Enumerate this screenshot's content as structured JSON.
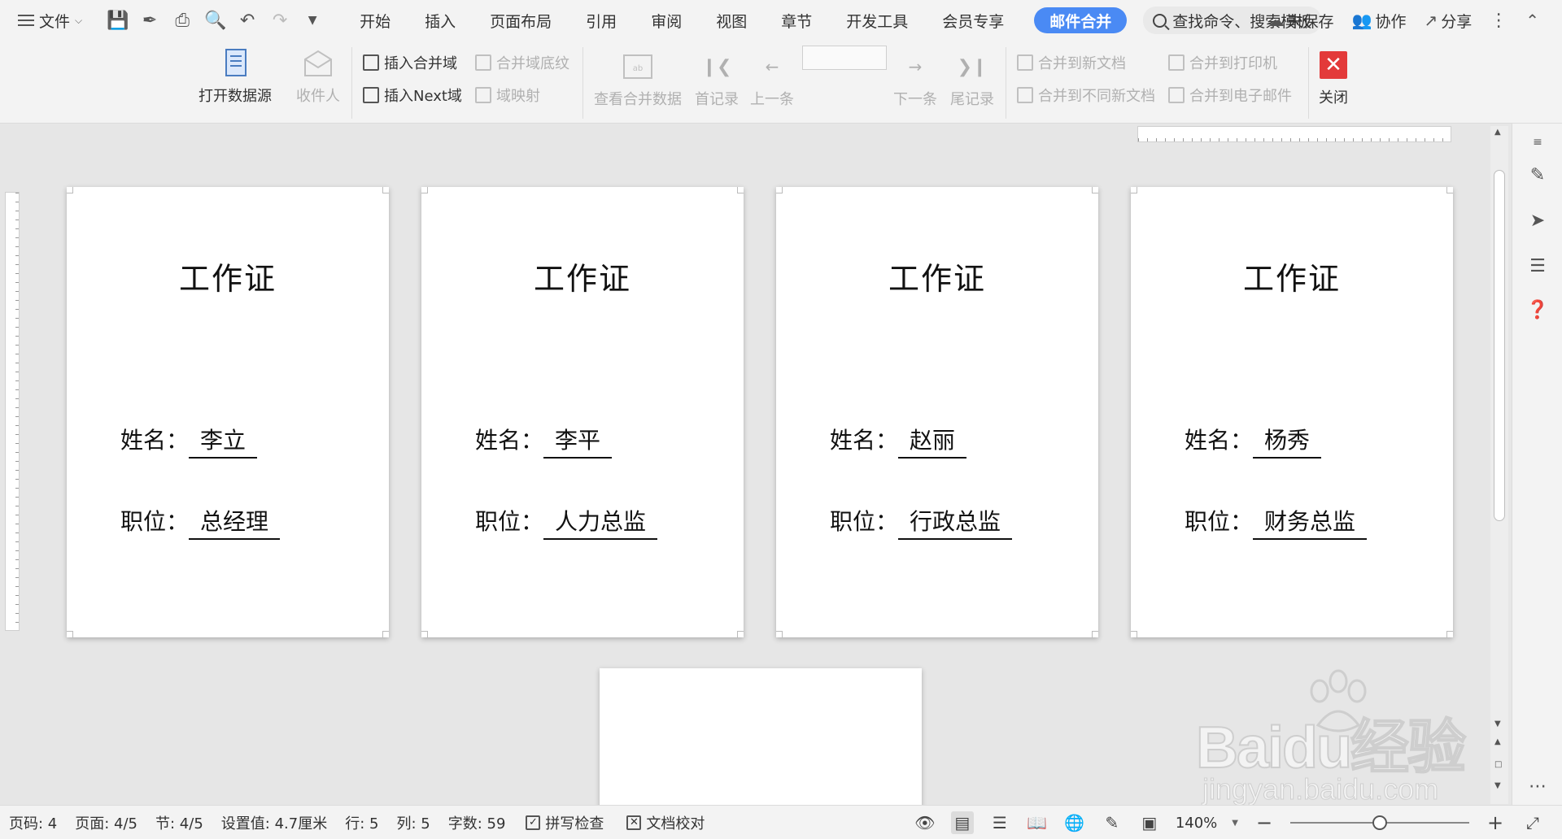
{
  "menubar": {
    "file_label": "文件",
    "tabs": [
      {
        "label": "开始"
      },
      {
        "label": "插入"
      },
      {
        "label": "页面布局"
      },
      {
        "label": "引用"
      },
      {
        "label": "审阅"
      },
      {
        "label": "视图"
      },
      {
        "label": "章节"
      },
      {
        "label": "开发工具"
      },
      {
        "label": "会员专享"
      },
      {
        "label": "邮件合并",
        "active": true
      }
    ],
    "search_label": "查找命令、搜索模板",
    "unsaved_label": "未保存",
    "collab_label": "协作",
    "share_label": "分享"
  },
  "ribbon": {
    "open_source": "打开数据源",
    "recipients": "收件人",
    "insert_merge_field": "插入合并域",
    "insert_next": "插入Next域",
    "merge_field_shading": "合并域底纹",
    "field_mapping": "域映射",
    "view_merged_data": "查看合并数据",
    "first_record": "首记录",
    "prev_record": "上一条",
    "record_value": "",
    "next_record": "下一条",
    "last_record": "尾记录",
    "merge_new_doc": "合并到新文档",
    "merge_separate_docs": "合并到不同新文档",
    "merge_printer": "合并到打印机",
    "merge_email": "合并到电子邮件",
    "close": "关闭"
  },
  "document": {
    "cards": [
      {
        "title": "工作证",
        "name_label": "姓名：",
        "name": "李立",
        "position_label": "职位：",
        "position": "总经理"
      },
      {
        "title": "工作证",
        "name_label": "姓名：",
        "name": "李平",
        "position_label": "职位：",
        "position": "人力总监"
      },
      {
        "title": "工作证",
        "name_label": "姓名：",
        "name": "赵丽",
        "position_label": "职位：",
        "position": "行政总监"
      },
      {
        "title": "工作证",
        "name_label": "姓名：",
        "name": "杨秀",
        "position_label": "职位：",
        "position": "财务总监"
      }
    ]
  },
  "statusbar": {
    "page_code": "页码: 4",
    "page": "页面: 4/5",
    "section": "节: 4/5",
    "setting": "设置值: 4.7厘米",
    "row": "行: 5",
    "col": "列: 5",
    "word_count": "字数: 59",
    "spell_check": "拼写检查",
    "doc_proof": "文档校对",
    "zoom": "140%",
    "zoom_level": 0.5
  },
  "watermark": {
    "brand": "Baidu经验",
    "url": "jingyan.baidu.com"
  },
  "colors": {
    "accent": "#4a8af4",
    "close": "#e33a3a",
    "toolbar_bg": "#f3f3f3",
    "canvas_bg": "#e6e6e6"
  }
}
